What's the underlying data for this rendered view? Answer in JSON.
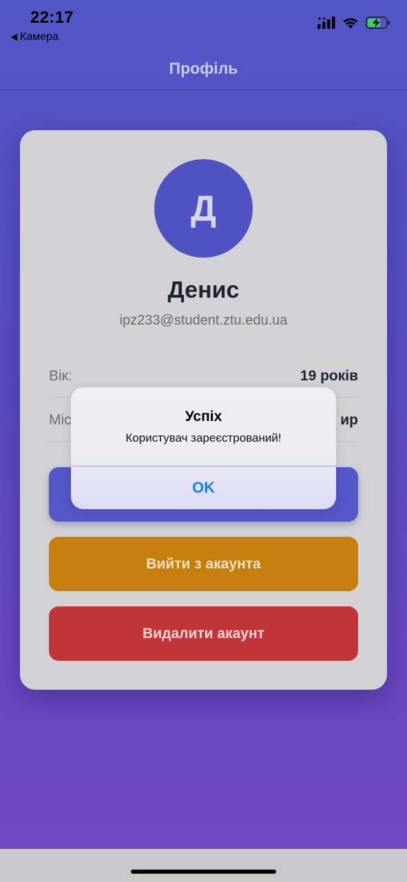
{
  "status_bar": {
    "time": "22:17",
    "back_app": "Камера",
    "icons": [
      "signal-icon",
      "wifi-icon",
      "battery-charging-icon"
    ]
  },
  "nav": {
    "title": "Профіль"
  },
  "profile": {
    "avatar_initial": "Д",
    "name": "Денис",
    "email": "ipz233@student.ztu.edu.ua",
    "info": [
      {
        "label": "Вік:",
        "value": "19 років"
      },
      {
        "label": "Міс",
        "value": "ир"
      }
    ]
  },
  "buttons": {
    "edit_label": "",
    "logout_label": "Вийти з акаунта",
    "delete_label": "Видалити акаунт"
  },
  "alert": {
    "title": "Успіх",
    "message": "Користувач зареєстрований!",
    "ok_label": "OK"
  },
  "colors": {
    "background_top": "#5356c6",
    "background_bottom": "#7048c4",
    "primary": "#5556c7",
    "warning": "#c67f0c",
    "danger": "#c13539",
    "alert_action": "#1e7fe0"
  }
}
